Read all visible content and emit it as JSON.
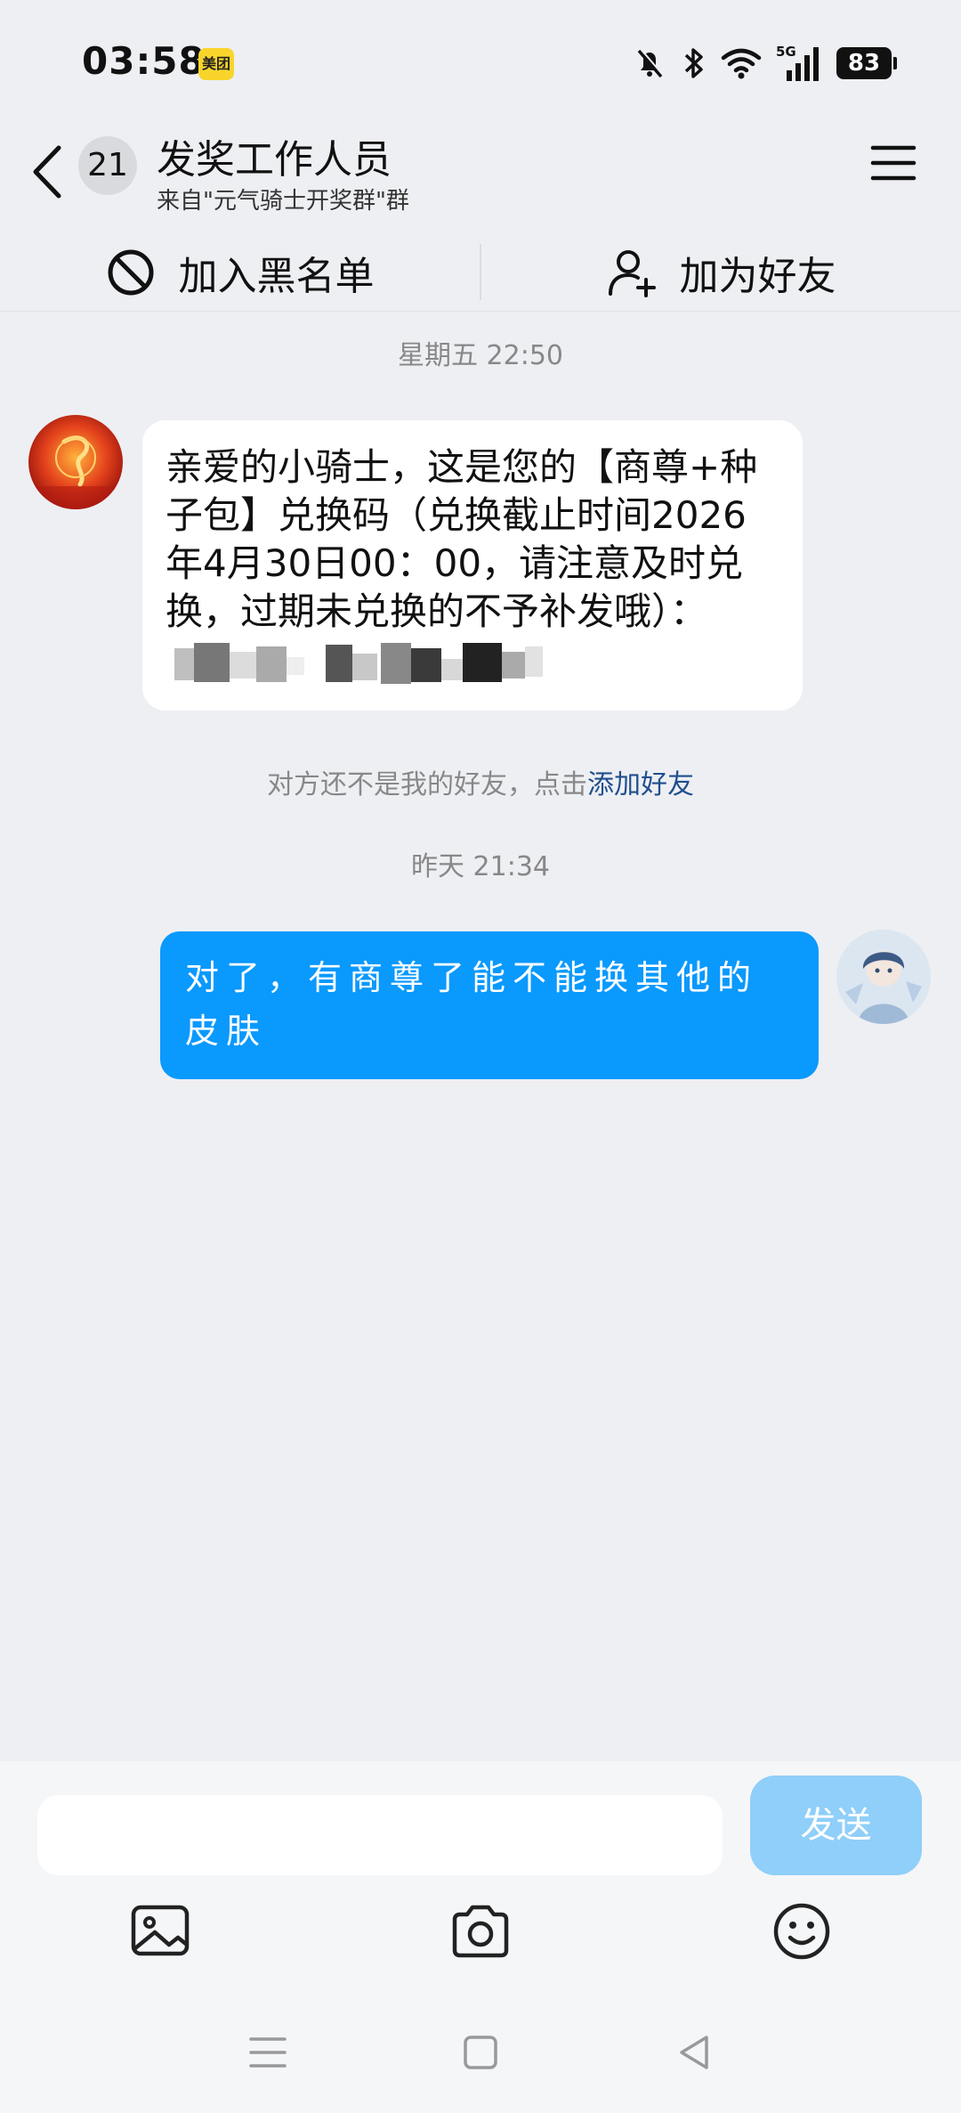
{
  "status_bar": {
    "time": "03:58",
    "app_badge": "美团",
    "battery": "83",
    "network": "5G"
  },
  "header": {
    "unread_count": "21",
    "title": "发奖工作人员",
    "subtitle": "来自\"元气骑士开奖群\"群"
  },
  "actions": {
    "blacklist_label": "加入黑名单",
    "add_friend_label": "加为好友"
  },
  "messages": [
    {
      "timestamp": "星期五 22:50",
      "text": "亲爱的小骑士，这是您的【商尊+种子包】兑换码（兑换截止时间2026年4月30日00：00，请注意及时兑换，过期未兑换的不予补发哦）："
    },
    {
      "timestamp": "昨天 21:34",
      "text": "对了，有商尊了能不能换其他的皮肤"
    }
  ],
  "notice": {
    "text": "对方还不是我的好友，点击",
    "link": "添加好友"
  },
  "composer": {
    "send_label": "发送"
  },
  "colors": {
    "outgoing_bubble": "#0a99fd",
    "send_button_disabled": "#8fcff9",
    "link": "#1f4f8e"
  }
}
